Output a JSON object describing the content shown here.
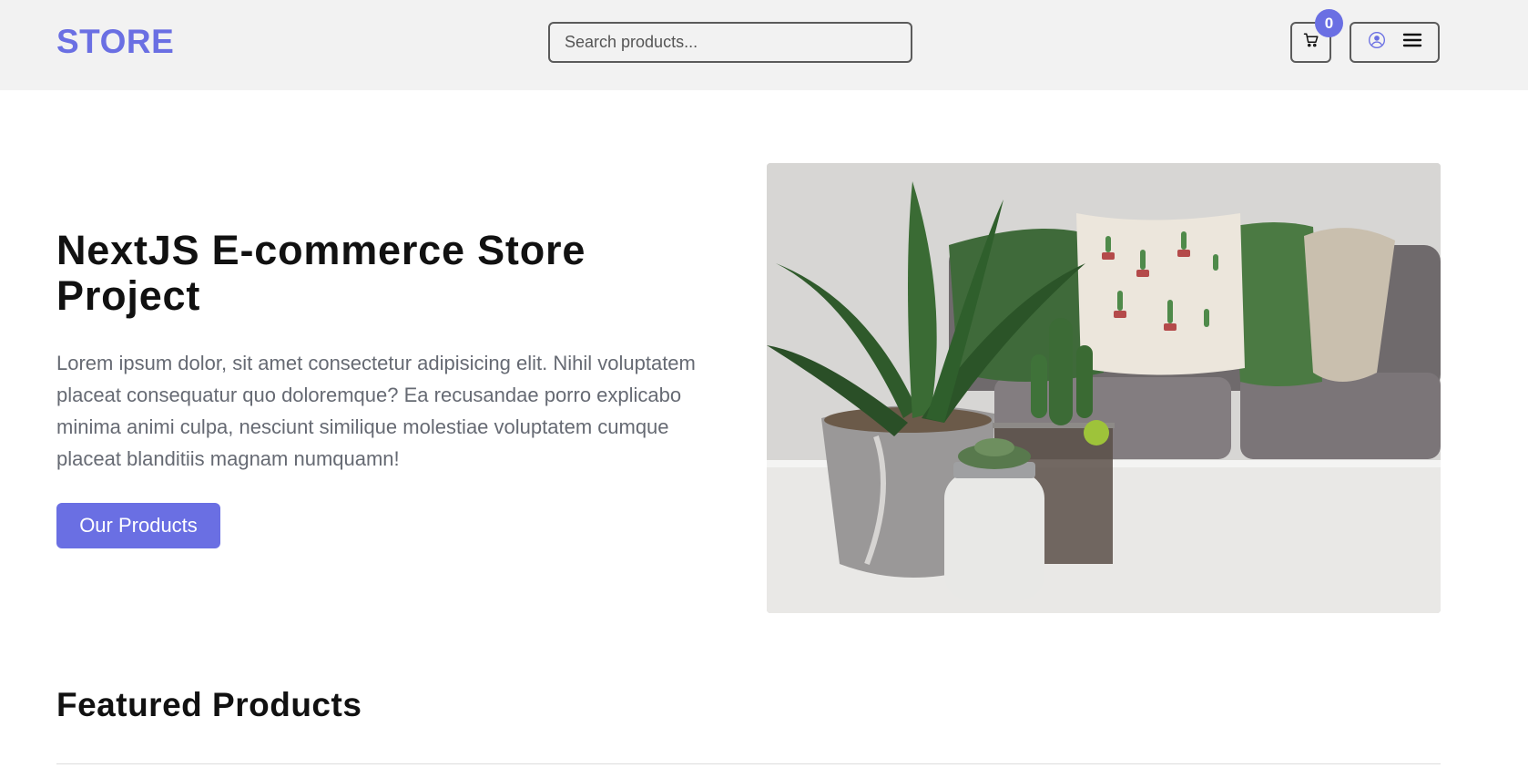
{
  "header": {
    "logo": "STORE",
    "search_placeholder": "Search products...",
    "cart_count": "0",
    "icons": {
      "cart": "cart-icon",
      "user": "user-circle-icon",
      "menu": "hamburger-menu-icon"
    }
  },
  "hero": {
    "title": "NextJS E-commerce Store Project",
    "description": "Lorem ipsum dolor, sit amet consectetur adipisicing elit. Nihil voluptatem placeat consequatur quo doloremque? Ea recusandae porro explicabo minima animi culpa, nesciunt similique molestiae voluptatem cumque placeat blanditiis magnam numquamn!",
    "cta_label": "Our Products"
  },
  "featured": {
    "title": "Featured Products"
  },
  "colors": {
    "accent": "#6a6fe3",
    "header_bg": "#f2f2f2",
    "text_muted": "#666a73"
  }
}
